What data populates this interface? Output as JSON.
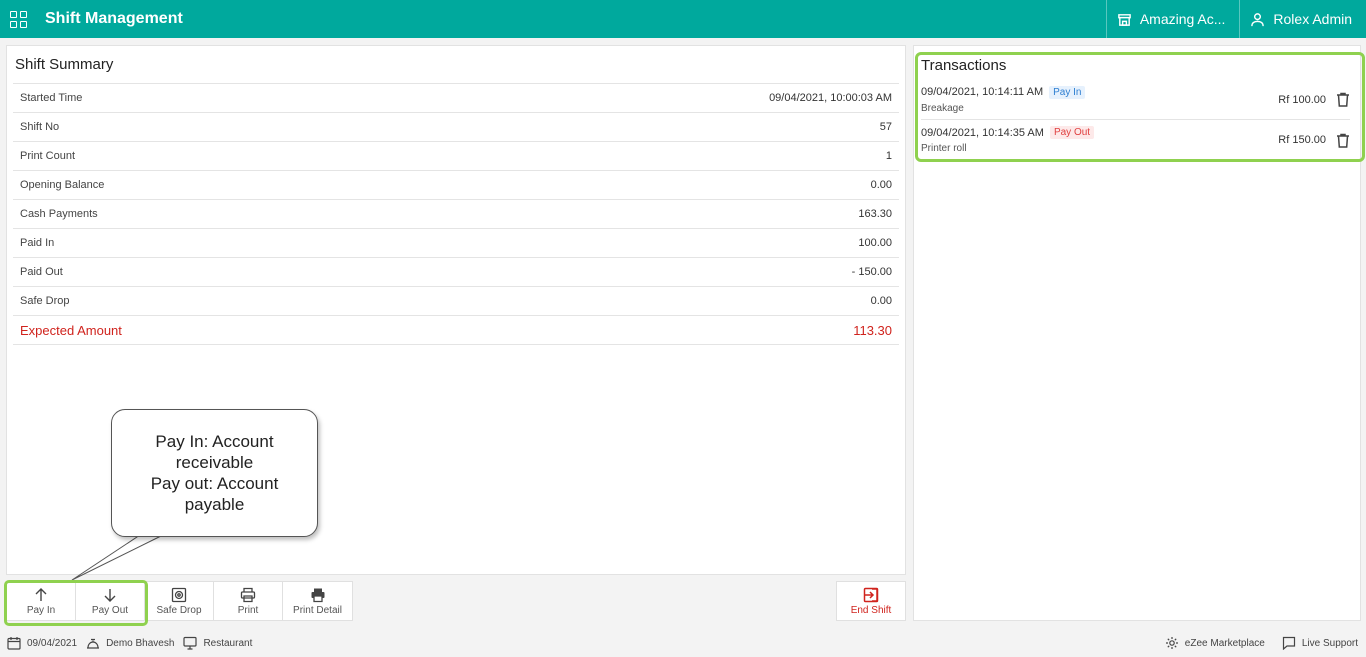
{
  "header": {
    "title": "Shift Management",
    "outlet": "Amazing Ac...",
    "user": "Rolex Admin"
  },
  "summary": {
    "title": "Shift Summary",
    "rows": [
      {
        "label": "Started Time",
        "value": "09/04/2021, 10:00:03 AM"
      },
      {
        "label": "Shift No",
        "value": "57"
      },
      {
        "label": "Print Count",
        "value": "1"
      },
      {
        "label": "Opening Balance",
        "value": "0.00"
      },
      {
        "label": "Cash Payments",
        "value": "163.30"
      },
      {
        "label": "Paid In",
        "value": "100.00"
      },
      {
        "label": "Paid Out",
        "value": "- 150.00"
      },
      {
        "label": "Safe Drop",
        "value": "0.00"
      }
    ],
    "expected": {
      "label": "Expected Amount",
      "value": "113.30"
    }
  },
  "callout": {
    "line1": "Pay In: Account",
    "line2": "receivable",
    "line3": "Pay out: Account",
    "line4": "payable"
  },
  "toolbar": {
    "pay_in": "Pay In",
    "pay_out": "Pay Out",
    "safe_drop": "Safe Drop",
    "print": "Print",
    "print_detail": "Print Detail",
    "end_shift": "End Shift"
  },
  "transactions": {
    "title": "Transactions",
    "items": [
      {
        "datetime": "09/04/2021, 10:14:11 AM",
        "type": "Pay In",
        "note": "Breakage",
        "amount": "Rf 100.00"
      },
      {
        "datetime": "09/04/2021, 10:14:35 AM",
        "type": "Pay Out",
        "note": "Printer roll",
        "amount": "Rf 150.00"
      }
    ]
  },
  "statusbar": {
    "date": "09/04/2021",
    "waiter": "Demo Bhavesh",
    "terminal": "Restaurant",
    "marketplace": "eZee Marketplace",
    "support": "Live Support"
  },
  "colors": {
    "header": "#00a99d",
    "highlight": "#8fd14f",
    "expected": "#d0231d"
  }
}
